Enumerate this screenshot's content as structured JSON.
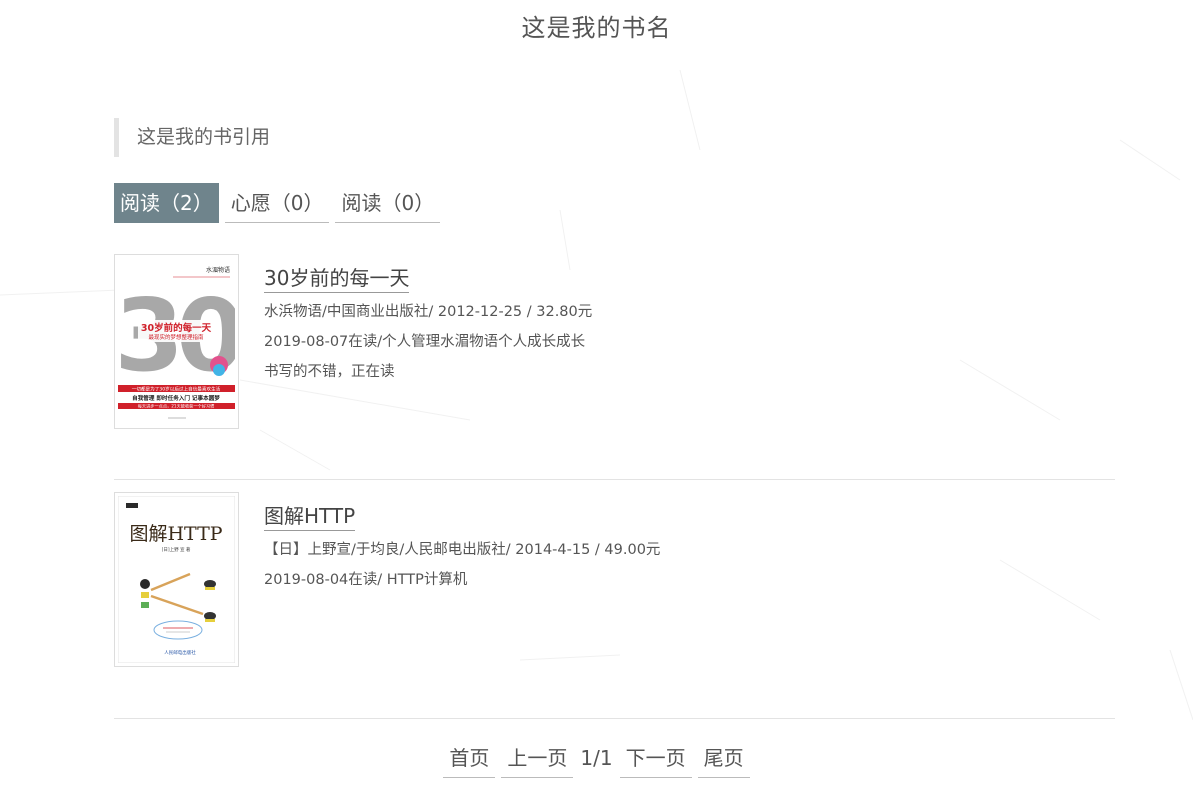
{
  "site": {
    "title": "这是我的书名"
  },
  "quote": {
    "text": "这是我的书引用"
  },
  "tabs": [
    {
      "label": "阅读（2）",
      "active": true
    },
    {
      "label": "心愿（0）",
      "active": false
    },
    {
      "label": "阅读（0）",
      "active": false
    }
  ],
  "books": [
    {
      "title": "30岁前的每一天",
      "publish_info": "水浜物语/中国商业出版社/ 2012-12-25 / 32.80元",
      "status_tags": "2019-08-07在读/个人管理水湄物语个人成长成长",
      "comment": "书写的不错，正在读",
      "cover": {
        "big_number": "30",
        "headline": "30岁前的每一天",
        "subhead": "最现实的梦想整理指南",
        "corner_text": "水湄物语",
        "band_text": "一切都是为了30岁以后过上自信最喜欢生活",
        "tags_line": "自我管理  即时任务入门  记事本圆梦",
        "tagline": "每天进步一点点，21天能收获一个好习惯"
      }
    },
    {
      "title": "图解HTTP",
      "publish_info": "【日】上野宣/于均良/人民邮电出版社/ 2014-4-15 / 49.00元",
      "status_tags": "2019-08-04在读/ HTTP计算机",
      "comment": "",
      "cover": {
        "headline": "图解HTTP",
        "author_line": "[日]上野 宣 著",
        "publisher": "人民邮电出版社"
      }
    }
  ],
  "pagination": {
    "first": "首页",
    "prev": "上一页",
    "current": "1/1",
    "next": "下一页",
    "last": "尾页"
  },
  "colors": {
    "active_tab": "#6f848c",
    "cover_red": "#d0202a",
    "cover_gray": "#a8a8a8"
  }
}
